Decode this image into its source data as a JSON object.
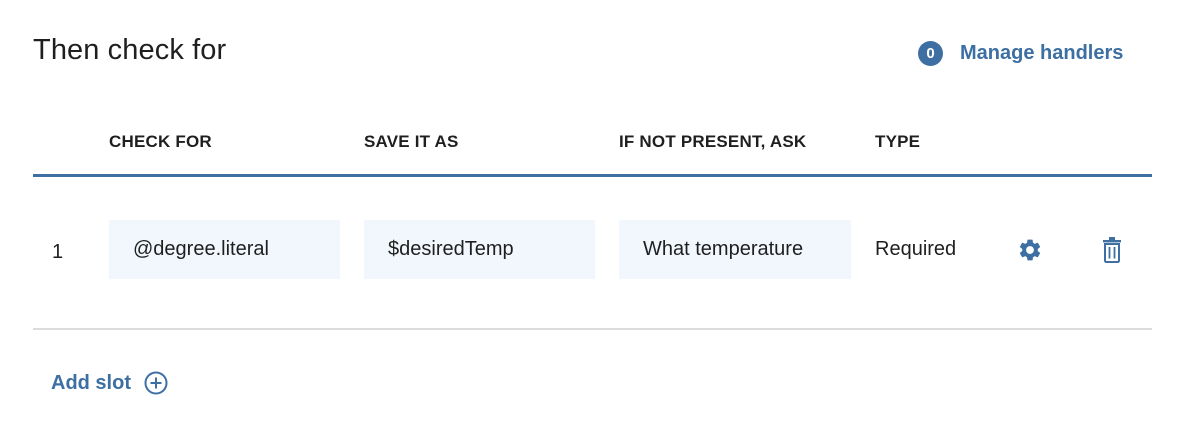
{
  "section": {
    "title": "Then check for"
  },
  "handlers": {
    "count": "0",
    "label": "Manage handlers"
  },
  "table": {
    "columns": [
      "CHECK FOR",
      "SAVE IT AS",
      "IF NOT PRESENT, ASK",
      "TYPE"
    ],
    "rows": [
      {
        "number": "1",
        "check_for": "@degree.literal",
        "save_as": "$desiredTemp",
        "ask": "What temperature",
        "type": "Required"
      }
    ]
  },
  "actions": {
    "add_slot_label": "Add slot"
  },
  "icons": {
    "settings": "gear-icon",
    "delete": "trash-icon",
    "add": "plus-circle-icon"
  },
  "colors": {
    "accent": "#3d6fa3",
    "field_bg": "#f2f7fd",
    "divider": "#dcdcdc"
  }
}
